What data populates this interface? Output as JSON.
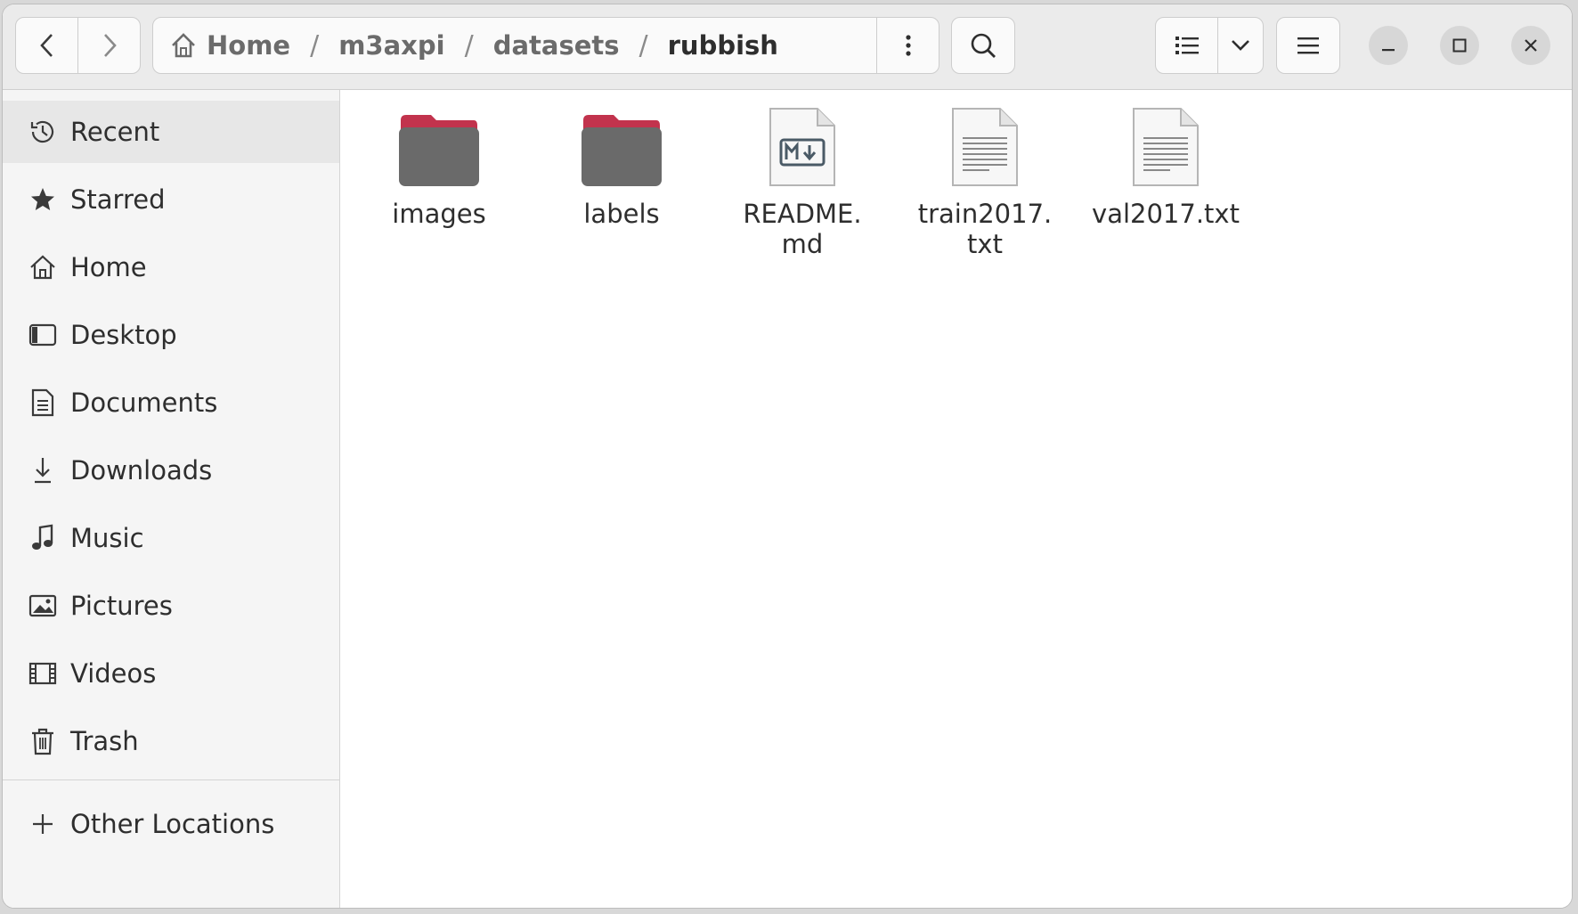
{
  "path": {
    "crumbs": [
      "Home",
      "m3axpi",
      "datasets",
      "rubbish"
    ],
    "separator": "/"
  },
  "sidebar": {
    "items": [
      {
        "label": "Recent",
        "icon": "clock-icon",
        "active": true
      },
      {
        "label": "Starred",
        "icon": "star-icon"
      },
      {
        "label": "Home",
        "icon": "home-icon"
      },
      {
        "label": "Desktop",
        "icon": "desktop-icon"
      },
      {
        "label": "Documents",
        "icon": "document-icon"
      },
      {
        "label": "Downloads",
        "icon": "download-icon"
      },
      {
        "label": "Music",
        "icon": "music-note-icon"
      },
      {
        "label": "Pictures",
        "icon": "picture-icon"
      },
      {
        "label": "Videos",
        "icon": "film-icon"
      },
      {
        "label": "Trash",
        "icon": "trash-icon"
      }
    ],
    "other_locations": {
      "label": "Other Locations",
      "icon": "plus-icon"
    }
  },
  "files": [
    {
      "name": "images",
      "type": "folder",
      "icon": "folder-icon"
    },
    {
      "name": "labels",
      "type": "folder",
      "icon": "folder-icon"
    },
    {
      "name": "README.\nmd",
      "type": "markdown",
      "icon": "markdown-file-icon"
    },
    {
      "name": "train2017.\ntxt",
      "type": "text",
      "icon": "text-file-icon"
    },
    {
      "name": "val2017.txt",
      "type": "text",
      "icon": "text-file-icon"
    }
  ],
  "colors": {
    "folder_top": "#c2334d",
    "folder_body": "#6a6a6a",
    "accent": "#e95420"
  }
}
